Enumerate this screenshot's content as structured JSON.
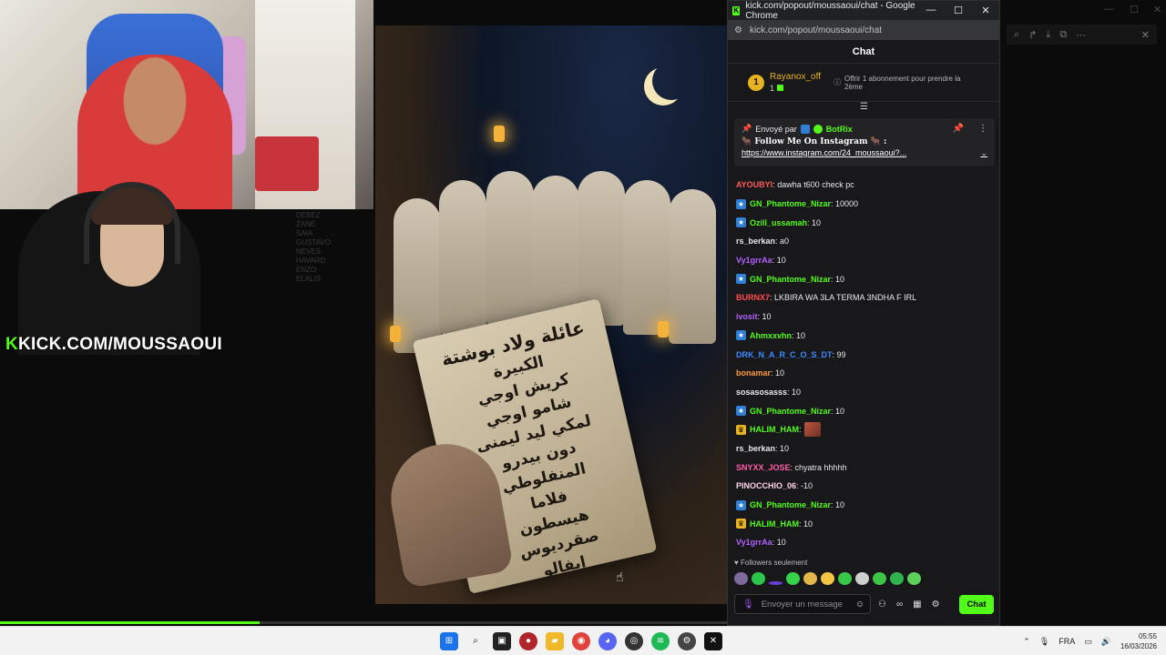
{
  "stream": {
    "handle_k": "K",
    "handle_text": "KICK.COM/MOUSSAOUI",
    "faded_list": [
      "DEBEZ",
      "ZANE",
      "SAIA",
      "GUSTAVO",
      "NEVES",
      "HAVARD",
      "ENZO",
      "ELALIS"
    ],
    "artwork": {
      "paper_title": "عائلة ولاد بوشتة",
      "paper_lines": [
        "الكبيرة",
        "كريش اوجي",
        "شامو اوجي",
        "لمكي ليد ليمنى",
        "دون بيدرو",
        "المنفلوطي",
        "فلاما",
        "هيسطون",
        "صقرديوس",
        "إيفالو"
      ]
    },
    "progress": 0.223
  },
  "window": {
    "title": "kick.com/popout/moussaoui/chat - Google Chrome",
    "url": "kick.com/popout/moussaoui/chat",
    "minimize": "—",
    "maximize": "☐",
    "close": "✕"
  },
  "chat": {
    "header": "Chat",
    "gift": {
      "rank": "1",
      "user": "Rayanox_off",
      "count": "1",
      "offer": "Offrir 1 abonnement pour prendre la 2ème"
    },
    "pinned": {
      "sent_by": "Envoyé par",
      "bot": "BotRix",
      "line1": "🐂 Follow Me On Instagram 🐂 :",
      "link": "https://www.instagram.com/24_moussaoui?..."
    },
    "messages": [
      {
        "user": "AYOUBYI",
        "text": ": dawha t600 check pc",
        "color": "#ff5a5a",
        "badge": ""
      },
      {
        "user": "GN_Phantome_Nizar",
        "text": ": 10000",
        "color": "#53fc18",
        "badge": "blue"
      },
      {
        "user": "Ozill_ussamah",
        "text": ": 10",
        "color": "#53fc18",
        "badge": "blue"
      },
      {
        "user": "rs_berkan",
        "text": ": a0",
        "color": "#e8e8e8",
        "badge": ""
      },
      {
        "user": "Vy1grrAa",
        "text": ": 10",
        "color": "#b062ff",
        "badge": ""
      },
      {
        "user": "GN_Phantome_Nizar",
        "text": ": 10",
        "color": "#53fc18",
        "badge": "blue"
      },
      {
        "user": "BURNX7",
        "text": ": LKBIRA WA 3LA TERMA 3NDHA F IRL",
        "color": "#ff4d4d",
        "badge": ""
      },
      {
        "user": "ivosit",
        "text": ": 10",
        "color": "#b062ff",
        "badge": ""
      },
      {
        "user": "Ahmxxvhn",
        "text": ": 10",
        "color": "#53fc18",
        "badge": "blue"
      },
      {
        "user": "DRK_N_A_R_C_O_S_DT",
        "text": ": 99",
        "color": "#3d8bff",
        "badge": ""
      },
      {
        "user": "bonamar",
        "text": ": 10",
        "color": "#ff9a3c",
        "badge": ""
      },
      {
        "user": "sosasosasss",
        "text": ": 10",
        "color": "#e8e8e8",
        "badge": ""
      },
      {
        "user": "GN_Phantome_Nizar",
        "text": ": 10",
        "color": "#53fc18",
        "badge": "blue"
      },
      {
        "user": "HALIM_HAM",
        "text": ":",
        "color": "#53fc18",
        "badge": "gold",
        "emote": true
      },
      {
        "user": "rs_berkan",
        "text": ": 10",
        "color": "#e8e8e8",
        "badge": ""
      },
      {
        "user": "SNYXX_JOSE",
        "text": ": chyatra hhhhh",
        "color": "#ff5ea8",
        "badge": ""
      },
      {
        "user": "PINOCCHIO_06",
        "text": ": -10",
        "color": "#ffd1e8",
        "badge": ""
      },
      {
        "user": "GN_Phantome_Nizar",
        "text": ": 10",
        "color": "#53fc18",
        "badge": "blue"
      },
      {
        "user": "HALIM_HAM",
        "text": ": 10",
        "color": "#53fc18",
        "badge": "gold"
      },
      {
        "user": "Vy1grrAa",
        "text": ": 10",
        "color": "#b062ff",
        "badge": ""
      }
    ],
    "followers_only": "Followers seulement",
    "input_placeholder": "Envoyer un message",
    "send_label": "Chat"
  },
  "taskbar": {
    "lang": "FRA",
    "time": "05:55",
    "date": "16/03/2026"
  }
}
